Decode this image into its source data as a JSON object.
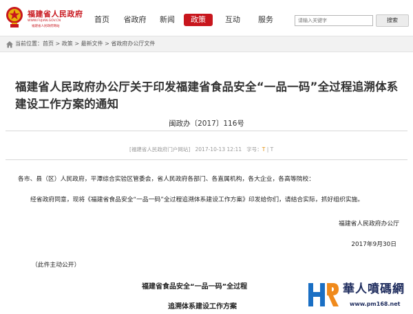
{
  "header": {
    "logo_cn": "福建省人民政府",
    "logo_en": "WWW.FUJIAN.GOV.CN",
    "logo_en2": "福建省人民政府网站"
  },
  "nav": {
    "items": [
      {
        "label": "首页"
      },
      {
        "label": "省政府"
      },
      {
        "label": "新闻"
      },
      {
        "label": "政策"
      },
      {
        "label": "互动"
      },
      {
        "label": "服务"
      }
    ],
    "active_index": 3
  },
  "search": {
    "placeholder": "请输入关键字",
    "button_label": "搜索"
  },
  "breadcrumb": {
    "prefix": "当前位置：",
    "items": [
      "首页",
      "政策",
      "最新文件",
      "省政府办公厅文件"
    ],
    "separator": " > "
  },
  "article": {
    "title": "福建省人民政府办公厅关于印发福建省食品安全“一品一码”全过程追溯体系建设工作方案的通知",
    "doc_number": "闽政办〔2017〕116号",
    "meta": {
      "source": "[福建省人民政府门户网站]",
      "date": "2017-10-13 12:11",
      "font_label": "字号：",
      "font_large": "T",
      "font_sep": "|",
      "font_small": "T"
    },
    "p1": "各市、县（区）人民政府，平潭综合实验区管委会，省人民政府各部门、各直属机构，各大企业，各高等院校：",
    "p2": "经省政府同意，现将《福建省食品安全“一品一码”全过程追溯体系建设工作方案》印发给你们，请结合实际，抓好组织实施。",
    "signature_org": "福建省人民政府办公厅",
    "signature_date": "2017年9月30日",
    "public_note": "（此件主动公开）",
    "subtitle_1": "福建省食品安全“一品一码”全过程",
    "subtitle_2": "追溯体系建设工作方案"
  },
  "watermark": {
    "cn": "華人噴碼網",
    "url": "www.pm168.net"
  },
  "colors": {
    "brand_red": "#c8161d",
    "watermark_navy": "#1c2a5c",
    "watermark_blue": "#1a6fc4",
    "meta_highlight": "#e08900"
  }
}
